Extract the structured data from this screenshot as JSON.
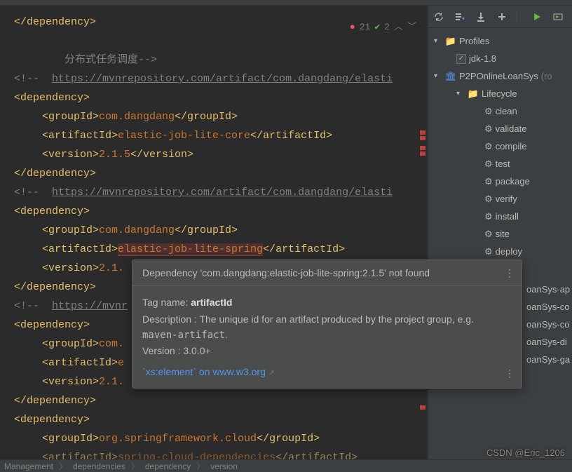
{
  "status": {
    "errors": "21",
    "warnings": "2"
  },
  "code": {
    "close_dep": "</dependency>",
    "comment_chinese": "        分布式任务调度-->",
    "comment1_prefix": "<!--  ",
    "comment1_url": "https://mvnrepository.com/artifact/com.dangdang/elasti",
    "open_dep": "<dependency>",
    "groupId_open": "<groupId>",
    "groupId_close": "</groupId>",
    "groupId_val1": "com.dangdang",
    "artifactId_open": "<artifactId>",
    "artifactId_close": "</artifactId>",
    "artifactId_val1": "elastic-job-lite-core",
    "version_open": "<version>",
    "version_close": "</version>",
    "version_val1": "2.1.5",
    "comment2_url": "https://mvnrepository.com/artifact/com.dangdang/elasti",
    "artifactId_val2": "elastic-job-lite-spring",
    "version_val2_partial": "2.1.",
    "comment3_url": "https://mvnr",
    "groupId_val3_partial": "com.",
    "artifactId_val3_partial": "e",
    "version_val3_partial": "2.1.",
    "groupId_val4": "org.springframework.cloud",
    "artifactId_val4": "spring-cloud-dependencies"
  },
  "tooltip": {
    "error": "Dependency 'com.dangdang:elastic-job-lite-spring:2.1.5' not found",
    "tagname_label": "Tag name: ",
    "tagname": "artifactId",
    "desc_label": "Description : ",
    "desc": "The unique id for an artifact produced by the project group, e.g. ",
    "desc_code": "maven-artifact",
    "desc_end": ".",
    "version_label": "Version : ",
    "version": "3.0.0+",
    "link_code": "`xs:element`",
    "link_rest": " on www.w3.org"
  },
  "tree": {
    "profiles": "Profiles",
    "jdk": "jdk-1.8",
    "project": "P2POnlineLoanSys",
    "project_suffix": "(ro",
    "lifecycle": "Lifecycle",
    "phases": [
      "clean",
      "validate",
      "compile",
      "test",
      "package",
      "verify",
      "install",
      "site",
      "deploy"
    ],
    "modules": [
      "oanSys-ap",
      "oanSys-co",
      "oanSys-co",
      "oanSys-di",
      "oanSys-ga"
    ]
  },
  "breadcrumb": {
    "b1": "Management",
    "b2": "dependencies",
    "b3": "dependency",
    "b4": "version"
  },
  "watermark": "CSDN @Eric_1206"
}
